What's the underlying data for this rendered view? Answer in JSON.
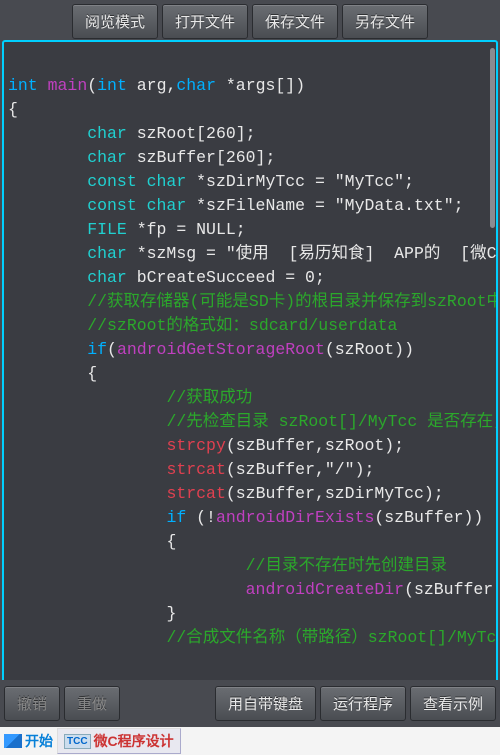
{
  "toolbar": {
    "top": {
      "read_mode": "阅览模式",
      "open_file": "打开文件",
      "save_file": "保存文件",
      "save_as": "另存文件"
    },
    "bottom": {
      "undo": "撤销",
      "redo": "重做",
      "use_builtin_kb": "用自带键盘",
      "run_program": "运行程序",
      "view_example": "查看示例"
    }
  },
  "code": {
    "l1_int": "int",
    "l1_main": " main",
    "l1_rest": "(",
    "l1_int2": "int",
    "l1_arg": " arg,",
    "l1_char": "char",
    "l1_args": " *args[])",
    "l2": "{",
    "l3_kw": "char",
    "l3_rest": " szRoot[260];",
    "l4_kw": "char",
    "l4_rest": " szBuffer[260];",
    "l5_kw": "const char",
    "l5_rest": " *szDirMyTcc = \"MyTcc\";",
    "l6_kw": "const char",
    "l6_rest": " *szFileName = \"MyData.txt\";",
    "l7_kw": "FILE",
    "l7_rest": " *fp = NULL;",
    "l8_kw": "char",
    "l8_rest": " *szMsg = \"使用  [易历知食]  APP的  [微C程序设计",
    "l9_kw": "char",
    "l9_rest": " bCreateSucceed = 0;",
    "l10": "//获取存储器(可能是SD卡)的根目录并保存到szRoot中",
    "l11": "//szRoot的格式如：sdcard/userdata",
    "l12_if": "if",
    "l12_fn": "androidGetStorageRoot",
    "l12_paren": "(",
    "l12_arg": "(szRoot))",
    "l13": "{",
    "l14": "//获取成功",
    "l15": "//先检查目录 szRoot[]/MyTcc 是否存在，不存在贝",
    "l16_fn": "strcpy",
    "l16_arg": "(szBuffer,szRoot);",
    "l17_fn": "strcat",
    "l17_arg": "(szBuffer,\"/\");",
    "l18_fn": "strcat",
    "l18_arg": "(szBuffer,szDirMyTcc);",
    "l19_if": "if",
    "l19_paren": " (!",
    "l19_fn": "androidDirExists",
    "l19_arg": "(szBuffer))",
    "l20": "{",
    "l21": "//目录不存在时先创建目录",
    "l22_fn": "androidCreateDir",
    "l22_arg": "(szBuffer);",
    "l23": "}",
    "l24": "//合成文件名称（带路径）szRoot[]/MyTcc/MyDa"
  },
  "taskbar": {
    "start": "开始",
    "app_icon": "TCC",
    "app_title": "微C程序设计"
  }
}
